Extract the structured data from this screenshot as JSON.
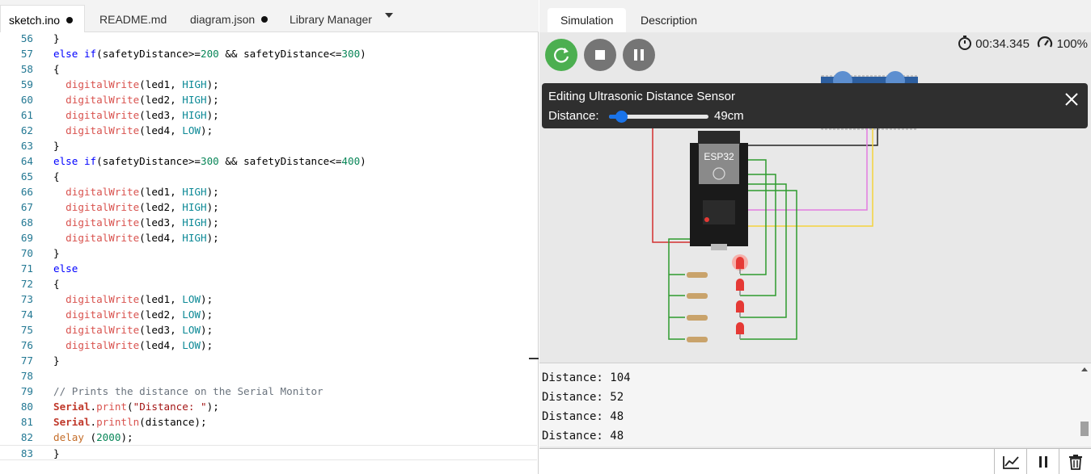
{
  "editor": {
    "tabs": [
      {
        "label": "sketch.ino",
        "modified": true
      },
      {
        "label": "README.md",
        "modified": false
      },
      {
        "label": "diagram.json",
        "modified": true
      },
      {
        "label": "Library Manager",
        "modified": false
      }
    ],
    "code_lines": [
      {
        "n": "56",
        "text": "}"
      },
      {
        "n": "57",
        "text": "else if(safetyDistance>=200 && safetyDistance<=300)"
      },
      {
        "n": "58",
        "text": "{"
      },
      {
        "n": "59",
        "text": "  digitalWrite(led1, HIGH);"
      },
      {
        "n": "60",
        "text": "  digitalWrite(led2, HIGH);"
      },
      {
        "n": "61",
        "text": "  digitalWrite(led3, HIGH);"
      },
      {
        "n": "62",
        "text": "  digitalWrite(led4, LOW);"
      },
      {
        "n": "63",
        "text": "}"
      },
      {
        "n": "64",
        "text": "else if(safetyDistance>=300 && safetyDistance<=400)"
      },
      {
        "n": "65",
        "text": "{"
      },
      {
        "n": "66",
        "text": "  digitalWrite(led1, HIGH);"
      },
      {
        "n": "67",
        "text": "  digitalWrite(led2, HIGH);"
      },
      {
        "n": "68",
        "text": "  digitalWrite(led3, HIGH);"
      },
      {
        "n": "69",
        "text": "  digitalWrite(led4, HIGH);"
      },
      {
        "n": "70",
        "text": "}"
      },
      {
        "n": "71",
        "text": "else"
      },
      {
        "n": "72",
        "text": "{"
      },
      {
        "n": "73",
        "text": "  digitalWrite(led1, LOW);"
      },
      {
        "n": "74",
        "text": "  digitalWrite(led2, LOW);"
      },
      {
        "n": "75",
        "text": "  digitalWrite(led3, LOW);"
      },
      {
        "n": "76",
        "text": "  digitalWrite(led4, LOW);"
      },
      {
        "n": "77",
        "text": "}"
      },
      {
        "n": "78",
        "text": ""
      },
      {
        "n": "79",
        "text": "// Prints the distance on the Serial Monitor"
      },
      {
        "n": "80",
        "text": "Serial.print(\"Distance: \");"
      },
      {
        "n": "81",
        "text": "Serial.println(distance);"
      },
      {
        "n": "82",
        "text": "delay (2000);"
      },
      {
        "n": "83",
        "text": "}"
      }
    ]
  },
  "simulator": {
    "tabs": [
      "Simulation",
      "Description"
    ],
    "timer": "00:34.345",
    "speed": "100%",
    "buttons": {
      "restart": "restart-icon",
      "stop": "stop-icon",
      "pause": "pause-icon"
    },
    "chip_label": "ESP32",
    "popup": {
      "title": "Editing Ultrasonic Distance Sensor",
      "label": "Distance:",
      "value_text": "49cm",
      "value_fraction": 0.12
    },
    "leds": [
      {
        "name": "led1",
        "on": true
      },
      {
        "name": "led2",
        "on": false
      },
      {
        "name": "led3",
        "on": false
      },
      {
        "name": "led4",
        "on": false
      }
    ]
  },
  "serial_monitor": {
    "lines": [
      "Distance: 104",
      "Distance: 52",
      "Distance: 48",
      "Distance: 48"
    ],
    "input_value": "",
    "buttons": [
      "chart-icon",
      "pause-icon",
      "trash-icon"
    ]
  },
  "colors": {
    "restart_button": "#4caf50",
    "control_button": "#757575",
    "slider": "#1a73e8",
    "popup_bg": "#2f2f2f",
    "led_red": "#e53935"
  }
}
